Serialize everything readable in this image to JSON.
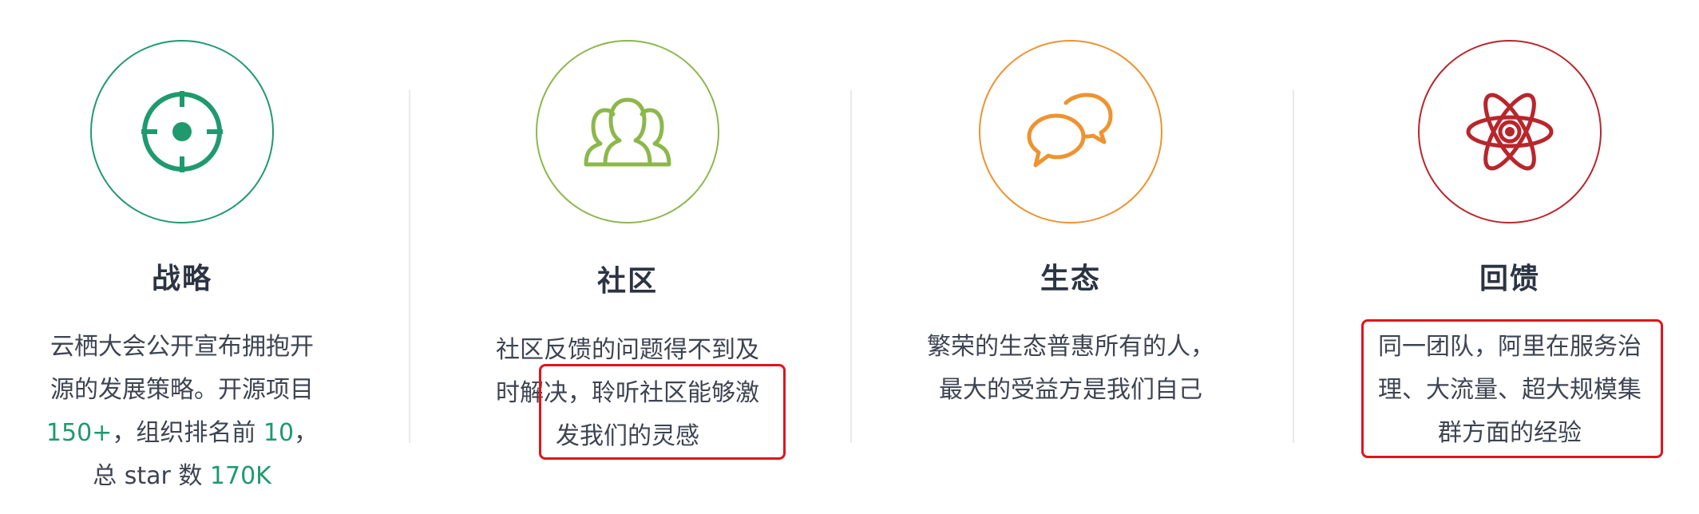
{
  "colors": {
    "strategy": "#1f9a6e",
    "community": "#8cb84b",
    "ecosystem": "#ee9330",
    "feedback": "#b8262c",
    "highlight": "#1f9a6e",
    "annotation": "#e0141e"
  },
  "features": [
    {
      "icon": "target-icon",
      "title": "战略",
      "lines": [
        "云栖大会公开宣布拥抱开",
        "源的发展策略。开源项目"
      ],
      "line3": {
        "num1": "150+",
        "mid": "，组织排名前 ",
        "num2": "10",
        "end": "，"
      },
      "line4": {
        "pre": "总 star 数 ",
        "num": "170K"
      }
    },
    {
      "icon": "users-icon",
      "title": "社区",
      "lines": [
        "社区反馈的问题得不到及",
        "时解决，聆听社区能够激",
        "发我们的灵感"
      ]
    },
    {
      "icon": "chat-bubbles-icon",
      "title": "生态",
      "lines": [
        "繁荣的生态普惠所有的人，",
        "最大的受益方是我们自己"
      ]
    },
    {
      "icon": "atom-icon",
      "title": "回馈",
      "lines": [
        "同一团队，阿里在服务治",
        "理、大流量、超大规模集",
        "群方面的经验"
      ]
    }
  ]
}
